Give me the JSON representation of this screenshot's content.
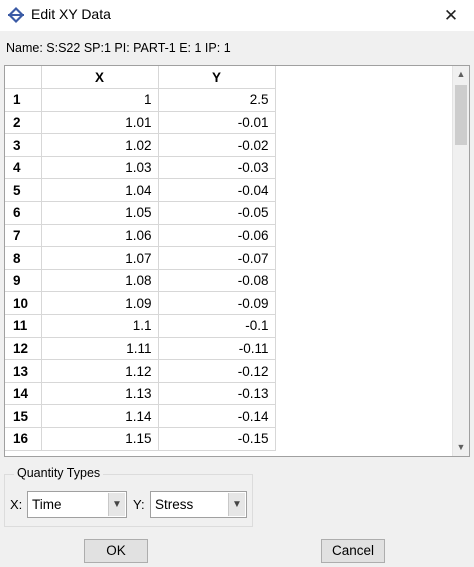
{
  "window": {
    "title": "Edit XY Data",
    "close_glyph": "✕"
  },
  "name_label": "Name: S:S22 SP:1 PI: PART-1 E: 1 IP: 1",
  "table": {
    "columns": [
      "X",
      "Y"
    ],
    "rows": [
      {
        "n": "1",
        "x": "1",
        "y": "2.5"
      },
      {
        "n": "2",
        "x": "1.01",
        "y": "-0.01"
      },
      {
        "n": "3",
        "x": "1.02",
        "y": "-0.02"
      },
      {
        "n": "4",
        "x": "1.03",
        "y": "-0.03"
      },
      {
        "n": "5",
        "x": "1.04",
        "y": "-0.04"
      },
      {
        "n": "6",
        "x": "1.05",
        "y": "-0.05"
      },
      {
        "n": "7",
        "x": "1.06",
        "y": "-0.06"
      },
      {
        "n": "8",
        "x": "1.07",
        "y": "-0.07"
      },
      {
        "n": "9",
        "x": "1.08",
        "y": "-0.08"
      },
      {
        "n": "10",
        "x": "1.09",
        "y": "-0.09"
      },
      {
        "n": "11",
        "x": "1.1",
        "y": "-0.1"
      },
      {
        "n": "12",
        "x": "1.11",
        "y": "-0.11"
      },
      {
        "n": "13",
        "x": "1.12",
        "y": "-0.12"
      },
      {
        "n": "14",
        "x": "1.13",
        "y": "-0.13"
      },
      {
        "n": "15",
        "x": "1.14",
        "y": "-0.14"
      },
      {
        "n": "16",
        "x": "1.15",
        "y": "-0.15"
      }
    ]
  },
  "quantity_types": {
    "legend": "Quantity Types",
    "x_label": "X:",
    "x_value": "Time",
    "y_label": "Y:",
    "y_value": "Stress"
  },
  "buttons": {
    "ok": "OK",
    "cancel": "Cancel"
  },
  "icons": {
    "app": "abaqus-app-icon",
    "close": "close-icon",
    "scroll_up": "▲",
    "scroll_down": "▼",
    "dropdown": "▼"
  },
  "colors": {
    "icon_blue": "#3b5ba5",
    "window_bg": "#f0f0f0"
  }
}
